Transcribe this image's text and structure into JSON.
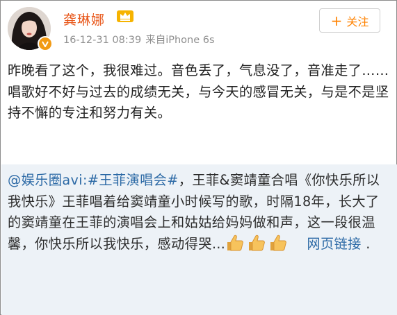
{
  "user": {
    "name": "龚琳娜",
    "timestamp": "16-12-31 08:39",
    "source": "来自iPhone 6s",
    "verified_mark": "V"
  },
  "follow_button": {
    "label": "关注"
  },
  "post": {
    "text": "昨晚看了这个，我很难过。音色丢了，气息没了，音准走了……唱歌好不好与过去的成绩无关，与今天的感冒无关，与是不是坚持不懈的专注和努力有关。"
  },
  "repost": {
    "mention": "@娱乐圈avi:",
    "topic": "#王菲演唱会#",
    "text": "，王菲&窦靖童合唱《你快乐所以我快乐》王菲唱着给窦靖童小时候写的歌，时隔18年，长大了的窦靖童在王菲的演唱会上和姑姑给妈妈做和声，这一段很温馨，你快乐所以我快乐，感动得哭…",
    "emoji": "thumbs-up-icon",
    "link_label": "网页链接",
    "trailing": " ."
  },
  "colors": {
    "name": "#e8571a",
    "accent": "#ff8200",
    "link": "#2d6aa6",
    "repost_bg": "#edf2f7"
  }
}
